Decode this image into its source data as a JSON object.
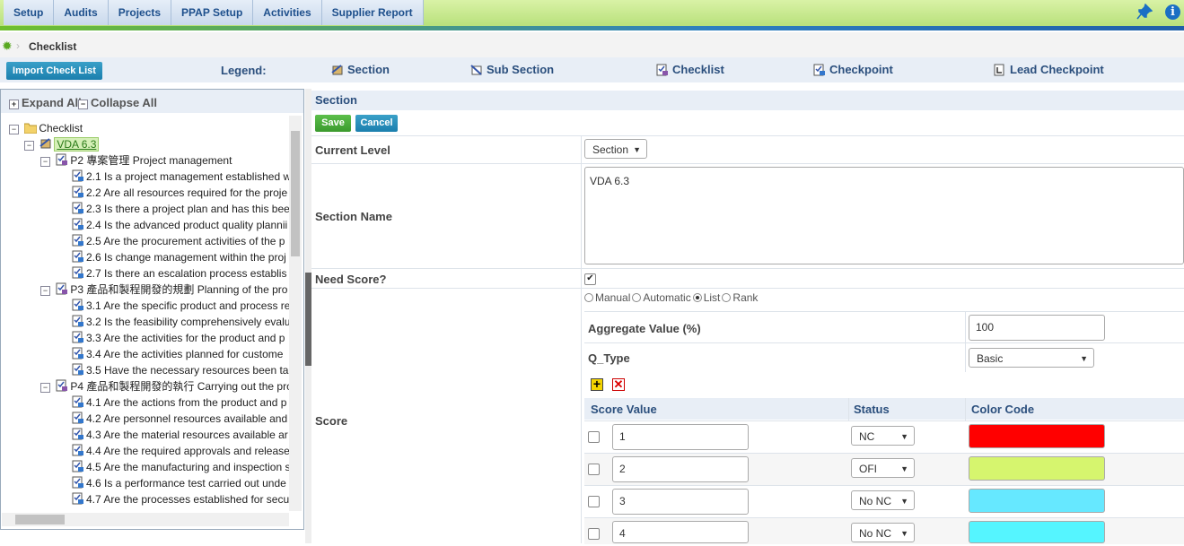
{
  "nav": {
    "tabs": [
      "Setup",
      "Audits",
      "Projects",
      "PPAP Setup",
      "Activities",
      "Supplier Report"
    ],
    "pin_icon": "pin-icon",
    "info_icon": "i"
  },
  "breadcrumb": {
    "title": "Checklist"
  },
  "legend": {
    "import_label": "Import Check List",
    "label": "Legend:",
    "items": [
      "Section",
      "Sub Section",
      "Checklist",
      "Checkpoint",
      "Lead Checkpoint"
    ]
  },
  "tree": {
    "expand_all": "Expand All",
    "collapse_all": "Collapse All",
    "rows": [
      "Checklist",
      "VDA 6.3",
      "P2 專案管理 Project management",
      "2.1 Is a project management established w",
      "2.2 Are all resources required for the proje",
      "2.3 Is there a project plan and has this bee",
      "2.4 Is the advanced product quality plannii",
      "2.5 Are the procurement activities of the p",
      "2.6 Is change management within the proj",
      "2.7 Is there an escalation process establis",
      "P3 產品和製程開發的規劃 Planning of the pro",
      "3.1 Are the specific product and process re",
      "3.2 Is the feasibility comprehensively evalu",
      "3.3 Are the activities for the product and p",
      "3.4 Are the activities planned for custome",
      "3.5 Have the necessary resources been tal",
      "P4 產品和製程開發的執行 Carrying out the pro",
      "4.1 Are the actions from the product and p",
      "4.2 Are personnel resources available and",
      "4.3 Are the material resources available ar",
      "4.4 Are the required approvals and release",
      "4.5 Are the manufacturing and inspection s",
      "4.6 Is a performance test carried out unde",
      "4.7 Are the processes established for secu"
    ]
  },
  "form": {
    "section_title": "Section",
    "save_label": "Save",
    "cancel_label": "Cancel",
    "current_level_label": "Current Level",
    "current_level_value": "Section",
    "section_name_label": "Section Name",
    "section_name_value": "VDA 6.3",
    "need_score_label": "Need Score?",
    "need_score_checked": true,
    "score_label": "Score",
    "score_modes": [
      "Manual",
      "Automatic",
      "List",
      "Rank"
    ],
    "score_mode_selected": "List",
    "aggregate_label": "Aggregate Value (%)",
    "aggregate_value": "100",
    "qtype_label": "Q_Type",
    "qtype_value": "Basic"
  },
  "score_grid": {
    "headers": [
      "Score Value",
      "Status",
      "Color Code"
    ],
    "rows": [
      {
        "value": "1",
        "status": "NC",
        "color": "#ff0000"
      },
      {
        "value": "2",
        "status": "OFI",
        "color": "#d6f56e"
      },
      {
        "value": "3",
        "status": "No NC",
        "color": "#66e8ff"
      },
      {
        "value": "4",
        "status": "No NC",
        "color": "#55f5ff"
      }
    ]
  }
}
